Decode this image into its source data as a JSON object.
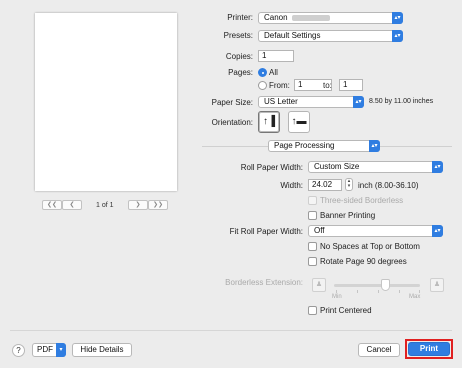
{
  "colors": {
    "accent": "#2f7de1",
    "highlight": "#e02020",
    "dialog_bg": "#ececec"
  },
  "preview": {
    "first_icon": "first-page-icon",
    "prev_icon": "prev-page-icon",
    "next_icon": "next-page-icon",
    "last_icon": "last-page-icon",
    "page_indicator": "1 of 1"
  },
  "printer": {
    "label": "Printer:",
    "value": "Canon"
  },
  "presets": {
    "label": "Presets:",
    "value": "Default Settings"
  },
  "copies": {
    "label": "Copies:",
    "value": "1"
  },
  "pages": {
    "label": "Pages:",
    "all_label": "All",
    "from_label": "From:",
    "from_value": "1",
    "to_label": "to:",
    "to_value": "1"
  },
  "paper_size": {
    "label": "Paper Size:",
    "value": "US Letter",
    "dimensions": "8.50 by 11.00 inches"
  },
  "orientation": {
    "label": "Orientation:",
    "portrait_icon": "portrait-icon",
    "landscape_icon": "landscape-icon"
  },
  "section_popup": {
    "value": "Page Processing"
  },
  "roll_paper_width": {
    "label": "Roll Paper Width:",
    "value": "Custom Size"
  },
  "width": {
    "label": "Width:",
    "value": "24.02",
    "unit": "inch (8.00-36.10)"
  },
  "three_sided_borderless": {
    "label": "Three-sided Borderless"
  },
  "banner_printing": {
    "label": "Banner Printing"
  },
  "fit_roll_paper_width": {
    "label": "Fit Roll Paper Width:",
    "value": "Off"
  },
  "no_spaces": {
    "label": "No Spaces at Top or Bottom"
  },
  "rotate_page": {
    "label": "Rotate Page 90 degrees"
  },
  "borderless_extension": {
    "label": "Borderless Extension:",
    "min_label": "Min",
    "max_label": "Max",
    "level": 0.6
  },
  "print_centered": {
    "label": "Print Centered"
  },
  "footer": {
    "help_label": "?",
    "pdf_label": "PDF",
    "hide_details_label": "Hide Details",
    "cancel_label": "Cancel",
    "print_label": "Print"
  }
}
